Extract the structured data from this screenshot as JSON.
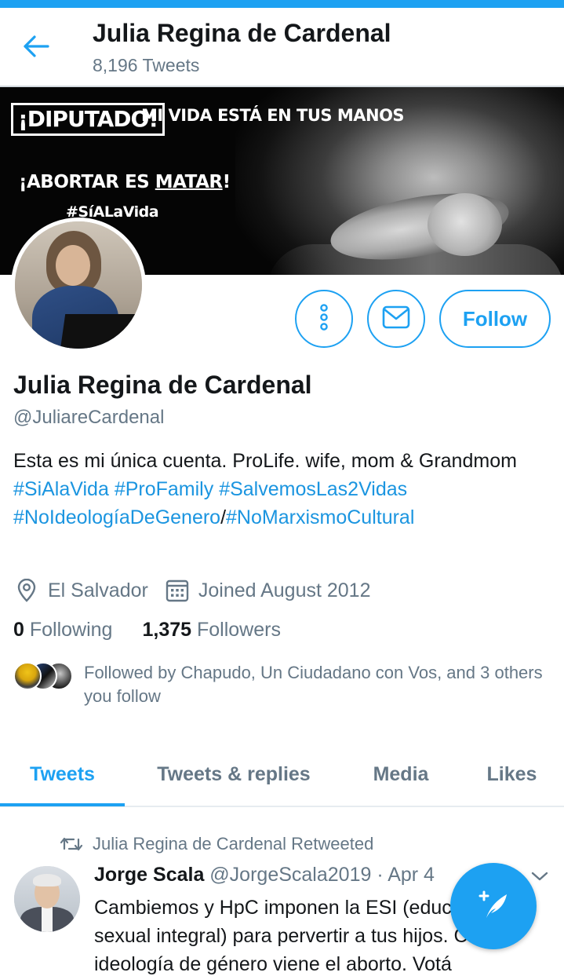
{
  "header": {
    "title": "Julia Regina de Cardenal",
    "tweet_count": "8,196 Tweets",
    "back_icon": "arrow-left-icon"
  },
  "banner": {
    "box_text": "¡DIPUTADO!",
    "line1": "MI VIDA ESTÁ EN TUS MANOS",
    "line2_prefix": "¡ABORTAR ES ",
    "line2_underlined": "MATAR",
    "line2_suffix": "!",
    "line3": "#SíALaVida"
  },
  "actions": {
    "more_icon": "more-vertical-icon",
    "message_icon": "envelope-icon",
    "follow_label": "Follow"
  },
  "profile": {
    "name": "Julia Regina de Cardenal",
    "handle": "@JuliareCardenal",
    "bio_text_1": "Esta es mi única cuenta. ProLife. wife, mom & Grandmom ",
    "bio_tag_1": "#SiAlaVida",
    "bio_space_1": " ",
    "bio_tag_2": "#ProFamily",
    "bio_space_2": " ",
    "bio_tag_3": "#SalvemosLas2Vidas",
    "bio_space_3": " ",
    "bio_tag_4": "#NoIdeologíaDeGenero",
    "bio_sep": "/",
    "bio_tag_5": "#NoMarxismoCultural",
    "location": "El Salvador",
    "location_icon": "location-pin-icon",
    "joined": "Joined August 2012",
    "joined_icon": "calendar-icon"
  },
  "stats": {
    "following_count": "0",
    "following_label": " Following",
    "followers_count": "1,375",
    "followers_label": " Followers"
  },
  "followed_by": {
    "text": "Followed by Chapudo, Un Ciudadano con Vos, and 3 others you follow"
  },
  "tabs": [
    {
      "label": "Tweets",
      "active": true
    },
    {
      "label": "Tweets & replies",
      "active": false
    },
    {
      "label": "Media",
      "active": false
    },
    {
      "label": "Likes",
      "active": false
    }
  ],
  "tweet": {
    "retweet_text": "Julia Regina de Cardenal Retweeted",
    "retweet_icon": "retweet-icon",
    "author_name": "Jorge Scala",
    "author_handle": " @JorgeScala2019 · Apr 4",
    "text": "Cambiemos y HpC imponen la ESI (educación sexual integral) para pervertir a tus hijos. Con la ideología de género viene el aborto. Votá",
    "chevron_icon": "chevron-down-icon"
  },
  "fab": {
    "icon": "compose-feather-icon"
  },
  "colors": {
    "accent": "#1da1f2",
    "link": "#1b95e0",
    "secondary_text": "#657786"
  }
}
